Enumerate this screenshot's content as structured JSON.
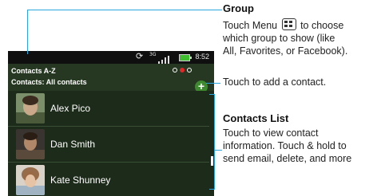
{
  "status_bar": {
    "sync_icon": "sync-icon",
    "network_label": "3G",
    "signal_icon": "signal-icon",
    "battery_icon": "battery-icon",
    "time": "8:52"
  },
  "header": {
    "title": "Contacts A-Z",
    "subtitle": "Contacts: All contacts",
    "page_indicator": {
      "count": 3,
      "active_index": 1,
      "active_color": "#e02a2a"
    },
    "add_label": "+"
  },
  "contacts": [
    {
      "name": "Alex Pico"
    },
    {
      "name": "Dan Smith"
    },
    {
      "name": "Kate Shunney"
    }
  ],
  "callouts": {
    "group": {
      "title": "Group",
      "line1_before": "Touch Menu",
      "line1_after": "to choose",
      "line2": "which group to show (like",
      "line3": "All, Favorites, or Facebook)."
    },
    "add": {
      "text": "Touch to add a contact."
    },
    "list": {
      "title": "Contacts  List",
      "line1": "Touch to view contact",
      "line2": "information. Touch & hold to",
      "line3": "send email, delete, and more"
    }
  },
  "colors": {
    "callout_line": "#2aa7de",
    "screen_bg": "#1d2b1a",
    "add_button": "#3d8a2f"
  }
}
